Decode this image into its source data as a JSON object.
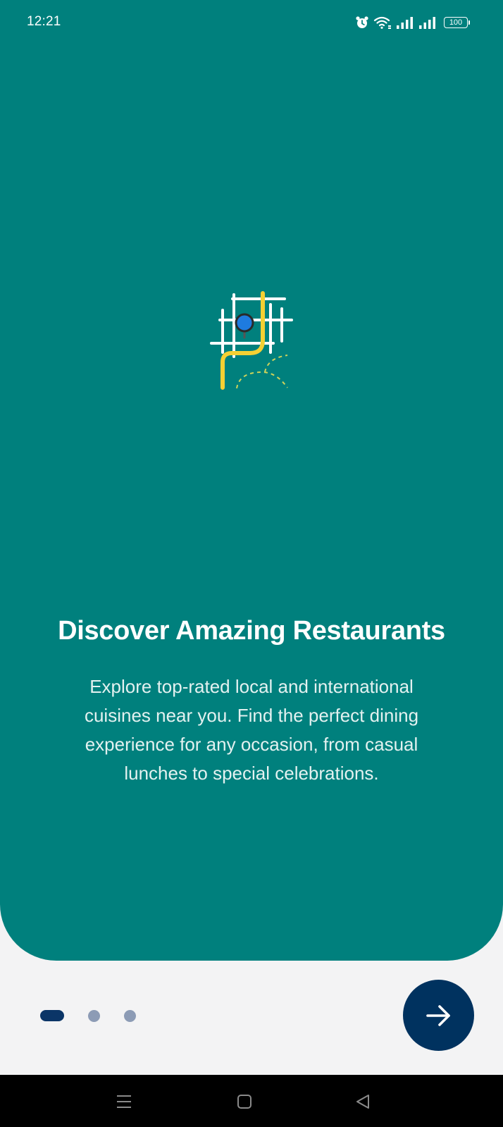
{
  "status_bar": {
    "time": "12:21",
    "battery_level": "100",
    "icons": [
      "alarm-icon",
      "wifi-icon",
      "signal-icon",
      "signal-icon",
      "battery-icon"
    ]
  },
  "onboarding": {
    "illustration_icon": "city-map-route-icon",
    "title": "Discover Amazing Restaurants",
    "description": "Explore top-rated local and international cuisines near you. Find the perfect dining experience for any occasion, from casual lunches to special celebrations.",
    "pages_total": 3,
    "current_page": 1,
    "next_icon": "arrow-right-icon"
  },
  "nav_bar": {
    "buttons": [
      "menu-icon",
      "home-icon",
      "back-icon"
    ]
  },
  "colors": {
    "hero_background": "#00807d",
    "page_background": "#f3f3f4",
    "accent_navy": "#00325f",
    "dot_active": "#0b3567",
    "dot_inactive": "#8c9bb5",
    "route_yellow": "#f5d033",
    "pin_blue": "#1e7be0"
  }
}
